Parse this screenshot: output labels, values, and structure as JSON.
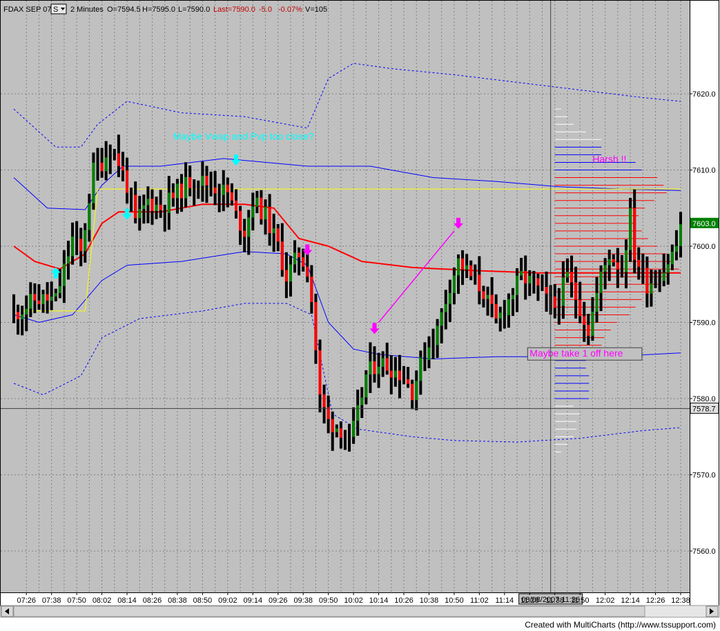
{
  "header": {
    "symbol": "FDAX SEP 07",
    "symbol_menu": "S",
    "interval": "2 Minutes",
    "open": "O=7594.5",
    "high": "H=7595.0",
    "low": "L=7590.0",
    "last": "Last=7590.0",
    "change": "-5.0",
    "change_pct": "-0.07%",
    "volume": "V=105"
  },
  "footer": "Created with MultiCharts (http://www.tssupport.com)",
  "colors": {
    "background": "#c0c0c0",
    "up_bar": "#008000",
    "down_bar": "#ff0000",
    "neutral_bar": "#000000",
    "vwap": "#ff0000",
    "band_inner": "#0000ff",
    "band_outer": "#0000ff",
    "pvp_line": "#ffff00",
    "buy_arrow": "#00ffff",
    "sell_arrow": "#ff00ff",
    "last_price_tag": "#008000"
  },
  "chart_data": {
    "type": "ohlc-bar",
    "ylim": [
      7555,
      7630
    ],
    "y_ticks": [
      7560,
      7570,
      7580,
      7590,
      7600,
      7610,
      7620
    ],
    "y_tick_labels": [
      "7560.0",
      "7570.0",
      "7580.0",
      "7590.0",
      "7600.0",
      "7610.0",
      "7620.0"
    ],
    "x_tick_labels": [
      "07:26",
      "07:38",
      "07:50",
      "08:02",
      "08:14",
      "08:26",
      "08:38",
      "08:50",
      "09:02",
      "09:14",
      "09:26",
      "09:38",
      "09:50",
      "10:02",
      "10:14",
      "10:26",
      "10:38",
      "10:50",
      "11:02",
      "11:14",
      "11:26",
      "11:38",
      "11:50",
      "12:02",
      "12:14",
      "12:26",
      "12:38"
    ],
    "cursor": {
      "date_label": "08/08/2007 11:36",
      "price_label": "7578.7",
      "time": "11:36",
      "price": 7578.7
    },
    "last_price": {
      "label": "7603.0",
      "value": 7603.0
    },
    "anchors": [
      {
        "t": "07:20",
        "p": 7591
      },
      {
        "t": "07:30",
        "p": 7593
      },
      {
        "t": "07:40",
        "p": 7593
      },
      {
        "t": "07:48",
        "p": 7601
      },
      {
        "t": "07:52",
        "p": 7599
      },
      {
        "t": "07:58",
        "p": 7610
      },
      {
        "t": "08:02",
        "p": 7611
      },
      {
        "t": "08:06",
        "p": 7613
      },
      {
        "t": "08:10",
        "p": 7611
      },
      {
        "t": "08:14",
        "p": 7608
      },
      {
        "t": "08:18",
        "p": 7603
      },
      {
        "t": "08:24",
        "p": 7606
      },
      {
        "t": "08:30",
        "p": 7605
      },
      {
        "t": "08:38",
        "p": 7607
      },
      {
        "t": "08:46",
        "p": 7609
      },
      {
        "t": "08:54",
        "p": 7608
      },
      {
        "t": "09:02",
        "p": 7607
      },
      {
        "t": "09:06",
        "p": 7604
      },
      {
        "t": "09:10",
        "p": 7602
      },
      {
        "t": "09:14",
        "p": 7606
      },
      {
        "t": "09:20",
        "p": 7604
      },
      {
        "t": "09:26",
        "p": 7600
      },
      {
        "t": "09:30",
        "p": 7596
      },
      {
        "t": "09:36",
        "p": 7599
      },
      {
        "t": "09:40",
        "p": 7597
      },
      {
        "t": "09:42",
        "p": 7593
      },
      {
        "t": "09:46",
        "p": 7580
      },
      {
        "t": "09:50",
        "p": 7577
      },
      {
        "t": "09:56",
        "p": 7576
      },
      {
        "t": "10:00",
        "p": 7574
      },
      {
        "t": "10:04",
        "p": 7578
      },
      {
        "t": "10:08",
        "p": 7583
      },
      {
        "t": "10:14",
        "p": 7585
      },
      {
        "t": "10:20",
        "p": 7584
      },
      {
        "t": "10:26",
        "p": 7583
      },
      {
        "t": "10:30",
        "p": 7581
      },
      {
        "t": "10:36",
        "p": 7586
      },
      {
        "t": "10:42",
        "p": 7589
      },
      {
        "t": "10:48",
        "p": 7595
      },
      {
        "t": "10:52",
        "p": 7598
      },
      {
        "t": "10:58",
        "p": 7596
      },
      {
        "t": "11:04",
        "p": 7594
      },
      {
        "t": "11:10",
        "p": 7590
      },
      {
        "t": "11:16",
        "p": 7593
      },
      {
        "t": "11:22",
        "p": 7596
      },
      {
        "t": "11:28",
        "p": 7595
      },
      {
        "t": "11:34",
        "p": 7593
      },
      {
        "t": "11:38",
        "p": 7592
      },
      {
        "t": "11:44",
        "p": 7596
      },
      {
        "t": "11:50",
        "p": 7592
      },
      {
        "t": "11:54",
        "p": 7589
      },
      {
        "t": "12:00",
        "p": 7596
      },
      {
        "t": "12:04",
        "p": 7599
      },
      {
        "t": "12:10",
        "p": 7597
      },
      {
        "t": "12:14",
        "p": 7604
      },
      {
        "t": "12:16",
        "p": 7599
      },
      {
        "t": "12:22",
        "p": 7595
      },
      {
        "t": "12:30",
        "p": 7597
      },
      {
        "t": "12:36",
        "p": 7600
      },
      {
        "t": "12:38",
        "p": 7603
      }
    ],
    "lines": [
      {
        "name": "vwap",
        "color": "#ff0000",
        "width": 2,
        "dash": "",
        "points": [
          {
            "t": "07:20",
            "p": 7600
          },
          {
            "t": "07:30",
            "p": 7598
          },
          {
            "t": "07:42",
            "p": 7597
          },
          {
            "t": "07:54",
            "p": 7599
          },
          {
            "t": "08:02",
            "p": 7603
          },
          {
            "t": "08:10",
            "p": 7604.5
          },
          {
            "t": "08:30",
            "p": 7604.5
          },
          {
            "t": "08:50",
            "p": 7605.5
          },
          {
            "t": "09:10",
            "p": 7605.5
          },
          {
            "t": "09:24",
            "p": 7605
          },
          {
            "t": "09:36",
            "p": 7601
          },
          {
            "t": "09:50",
            "p": 7600
          },
          {
            "t": "10:06",
            "p": 7598
          },
          {
            "t": "10:30",
            "p": 7597.2
          },
          {
            "t": "11:00",
            "p": 7596.8
          },
          {
            "t": "11:30",
            "p": 7596.5
          },
          {
            "t": "12:00",
            "p": 7596.5
          },
          {
            "t": "12:38",
            "p": 7596.5
          }
        ]
      },
      {
        "name": "upper-band-1",
        "color": "#0000ff",
        "width": 1,
        "dash": "",
        "points": [
          {
            "t": "07:20",
            "p": 7609
          },
          {
            "t": "07:36",
            "p": 7605
          },
          {
            "t": "07:54",
            "p": 7604.8
          },
          {
            "t": "08:02",
            "p": 7608
          },
          {
            "t": "08:12",
            "p": 7610.5
          },
          {
            "t": "08:30",
            "p": 7610.5
          },
          {
            "t": "09:00",
            "p": 7611.5
          },
          {
            "t": "09:20",
            "p": 7611
          },
          {
            "t": "09:40",
            "p": 7610.5
          },
          {
            "t": "10:10",
            "p": 7610.5
          },
          {
            "t": "10:40",
            "p": 7609
          },
          {
            "t": "11:10",
            "p": 7608.5
          },
          {
            "t": "11:40",
            "p": 7607.8
          },
          {
            "t": "12:10",
            "p": 7607.5
          },
          {
            "t": "12:38",
            "p": 7607.3
          }
        ]
      },
      {
        "name": "lower-band-1",
        "color": "#0000ff",
        "width": 1,
        "dash": "",
        "points": [
          {
            "t": "07:20",
            "p": 7591
          },
          {
            "t": "07:32",
            "p": 7590
          },
          {
            "t": "07:48",
            "p": 7591
          },
          {
            "t": "08:02",
            "p": 7595.5
          },
          {
            "t": "08:14",
            "p": 7597.5
          },
          {
            "t": "08:40",
            "p": 7598
          },
          {
            "t": "09:10",
            "p": 7599.3
          },
          {
            "t": "09:30",
            "p": 7599
          },
          {
            "t": "09:40",
            "p": 7597.5
          },
          {
            "t": "09:50",
            "p": 7590
          },
          {
            "t": "10:02",
            "p": 7586.5
          },
          {
            "t": "10:14",
            "p": 7585.8
          },
          {
            "t": "10:40",
            "p": 7585.2
          },
          {
            "t": "11:10",
            "p": 7585.5
          },
          {
            "t": "11:40",
            "p": 7585.5
          },
          {
            "t": "12:10",
            "p": 7585.6
          },
          {
            "t": "12:38",
            "p": 7586
          }
        ]
      },
      {
        "name": "upper-band-2",
        "color": "#0000ff",
        "width": 1,
        "dash": "3,3",
        "points": [
          {
            "t": "07:20",
            "p": 7618
          },
          {
            "t": "07:40",
            "p": 7613
          },
          {
            "t": "07:52",
            "p": 7613
          },
          {
            "t": "08:00",
            "p": 7616
          },
          {
            "t": "08:14",
            "p": 7619
          },
          {
            "t": "08:40",
            "p": 7617.5
          },
          {
            "t": "09:10",
            "p": 7617
          },
          {
            "t": "09:30",
            "p": 7616
          },
          {
            "t": "09:40",
            "p": 7615.5
          },
          {
            "t": "09:50",
            "p": 7622
          },
          {
            "t": "10:02",
            "p": 7624
          },
          {
            "t": "10:20",
            "p": 7623.3
          },
          {
            "t": "10:50",
            "p": 7622.5
          },
          {
            "t": "11:20",
            "p": 7621.5
          },
          {
            "t": "11:50",
            "p": 7620.5
          },
          {
            "t": "12:20",
            "p": 7619.5
          },
          {
            "t": "12:38",
            "p": 7619
          }
        ]
      },
      {
        "name": "lower-band-2",
        "color": "#0000ff",
        "width": 1,
        "dash": "3,3",
        "points": [
          {
            "t": "07:20",
            "p": 7582
          },
          {
            "t": "07:34",
            "p": 7580.5
          },
          {
            "t": "07:52",
            "p": 7583
          },
          {
            "t": "08:02",
            "p": 7588
          },
          {
            "t": "08:20",
            "p": 7590.5
          },
          {
            "t": "08:50",
            "p": 7591.5
          },
          {
            "t": "09:10",
            "p": 7592.5
          },
          {
            "t": "09:30",
            "p": 7592.5
          },
          {
            "t": "09:42",
            "p": 7591
          },
          {
            "t": "09:52",
            "p": 7578
          },
          {
            "t": "10:04",
            "p": 7576
          },
          {
            "t": "10:30",
            "p": 7575
          },
          {
            "t": "10:50",
            "p": 7574.5
          },
          {
            "t": "11:20",
            "p": 7574.3
          },
          {
            "t": "11:50",
            "p": 7574.8
          },
          {
            "t": "12:20",
            "p": 7575.8
          },
          {
            "t": "12:38",
            "p": 7576.2
          }
        ]
      },
      {
        "name": "pvp-line",
        "color": "#ffff00",
        "width": 1,
        "dash": "",
        "points": [
          {
            "t": "07:24",
            "p": 7591.5
          },
          {
            "t": "07:54",
            "p": 7591.5
          },
          {
            "t": "08:00",
            "p": 7607.5
          },
          {
            "t": "12:38",
            "p": 7607.5
          }
        ]
      }
    ],
    "profile": {
      "start_time": "11:38",
      "rows": [
        {
          "p": 7573,
          "len": 0.2,
          "color": "#ffffff"
        },
        {
          "p": 7574,
          "len": 0.4,
          "color": "#ffffff"
        },
        {
          "p": 7575,
          "len": 0.6,
          "color": "#ffffff"
        },
        {
          "p": 7576,
          "len": 0.7,
          "color": "#ffffff"
        },
        {
          "p": 7577,
          "len": 0.7,
          "color": "#ffffff"
        },
        {
          "p": 7578,
          "len": 0.8,
          "color": "#ffffff"
        },
        {
          "p": 7579,
          "len": 0.6,
          "color": "#ffffff"
        },
        {
          "p": 7580,
          "len": 1.1,
          "color": "#0000ff"
        },
        {
          "p": 7581,
          "len": 1.1,
          "color": "#0000ff"
        },
        {
          "p": 7582,
          "len": 1.1,
          "color": "#0000ff"
        },
        {
          "p": 7583,
          "len": 1.1,
          "color": "#0000ff"
        },
        {
          "p": 7584,
          "len": 1.0,
          "color": "#0000ff"
        },
        {
          "p": 7585,
          "len": 1.0,
          "color": "#0000ff"
        },
        {
          "p": 7586,
          "len": 1.1,
          "color": "#ff0000"
        },
        {
          "p": 7587,
          "len": 1.5,
          "color": "#ff0000"
        },
        {
          "p": 7588,
          "len": 1.6,
          "color": "#ff0000"
        },
        {
          "p": 7589,
          "len": 1.8,
          "color": "#ff0000"
        },
        {
          "p": 7590,
          "len": 2.0,
          "color": "#ff0000"
        },
        {
          "p": 7591,
          "len": 2.4,
          "color": "#ff0000"
        },
        {
          "p": 7592,
          "len": 2.6,
          "color": "#ff0000"
        },
        {
          "p": 7593,
          "len": 2.8,
          "color": "#ff0000"
        },
        {
          "p": 7594,
          "len": 3.2,
          "color": "#ff0000"
        },
        {
          "p": 7595,
          "len": 3.4,
          "color": "#ff0000"
        },
        {
          "p": 7596,
          "len": 3.6,
          "color": "#ff0000"
        },
        {
          "p": 7597,
          "len": 4.0,
          "color": "#ff0000"
        },
        {
          "p": 7598,
          "len": 3.8,
          "color": "#ff0000"
        },
        {
          "p": 7599,
          "len": 3.6,
          "color": "#ff0000"
        },
        {
          "p": 7600,
          "len": 3.3,
          "color": "#ff0000"
        },
        {
          "p": 7601,
          "len": 3.0,
          "color": "#ff0000"
        },
        {
          "p": 7602,
          "len": 2.8,
          "color": "#ff0000"
        },
        {
          "p": 7603,
          "len": 2.6,
          "color": "#ff0000"
        },
        {
          "p": 7604,
          "len": 2.7,
          "color": "#ff0000"
        },
        {
          "p": 7605,
          "len": 2.9,
          "color": "#ff0000"
        },
        {
          "p": 7606,
          "len": 3.2,
          "color": "#ff0000"
        },
        {
          "p": 7607,
          "len": 3.6,
          "color": "#ff0000"
        },
        {
          "p": 7608,
          "len": 3.5,
          "color": "#ff0000"
        },
        {
          "p": 7609,
          "len": 3.3,
          "color": "#ff0000"
        },
        {
          "p": 7610,
          "len": 2.8,
          "color": "#0000ff"
        },
        {
          "p": 7611,
          "len": 2.6,
          "color": "#0000ff"
        },
        {
          "p": 7612,
          "len": 1.5,
          "color": "#0000ff"
        },
        {
          "p": 7613,
          "len": 1.5,
          "color": "#0000ff"
        },
        {
          "p": 7614,
          "len": 1.5,
          "color": "#ffffff"
        },
        {
          "p": 7615,
          "len": 1.0,
          "color": "#ffffff"
        },
        {
          "p": 7616,
          "len": 0.6,
          "color": "#ffffff"
        },
        {
          "p": 7617,
          "len": 0.4,
          "color": "#ffffff"
        },
        {
          "p": 7618,
          "len": 0.2,
          "color": "#ffffff"
        }
      ]
    },
    "arrows": [
      {
        "dir": "up",
        "color": "#00ffff",
        "t": "07:40",
        "p": 7596.5
      },
      {
        "dir": "down",
        "color": "#00ffff",
        "t": "08:14",
        "p": 7604.2
      },
      {
        "dir": "down",
        "color": "#00ffff",
        "t": "09:06",
        "p": 7611.3
      },
      {
        "dir": "down",
        "color": "#ff00ff",
        "t": "09:40",
        "p": 7599.5
      },
      {
        "dir": "down",
        "color": "#ff00ff",
        "t": "10:12",
        "p": 7589.2
      },
      {
        "dir": "down",
        "color": "#ff00ff",
        "t": "10:52",
        "p": 7603
      }
    ],
    "trendline": {
      "color": "#ff00ff",
      "from": {
        "t": "10:14",
        "p": 7590
      },
      "to": {
        "t": "10:50",
        "p": 7602
      }
    },
    "annotations": [
      {
        "text": "Maybe Vwap and Pvp too close?",
        "color": "#00ffff",
        "t": "08:36",
        "p": 7614,
        "boxed": false
      },
      {
        "text": "Harsh !!",
        "color": "#ff00ff",
        "t": "11:56",
        "p": 7611,
        "boxed": false
      },
      {
        "text": "Maybe take 1 off here",
        "color": "#ff00ff",
        "t": "11:26",
        "p": 7585.5,
        "boxed": true
      }
    ]
  }
}
